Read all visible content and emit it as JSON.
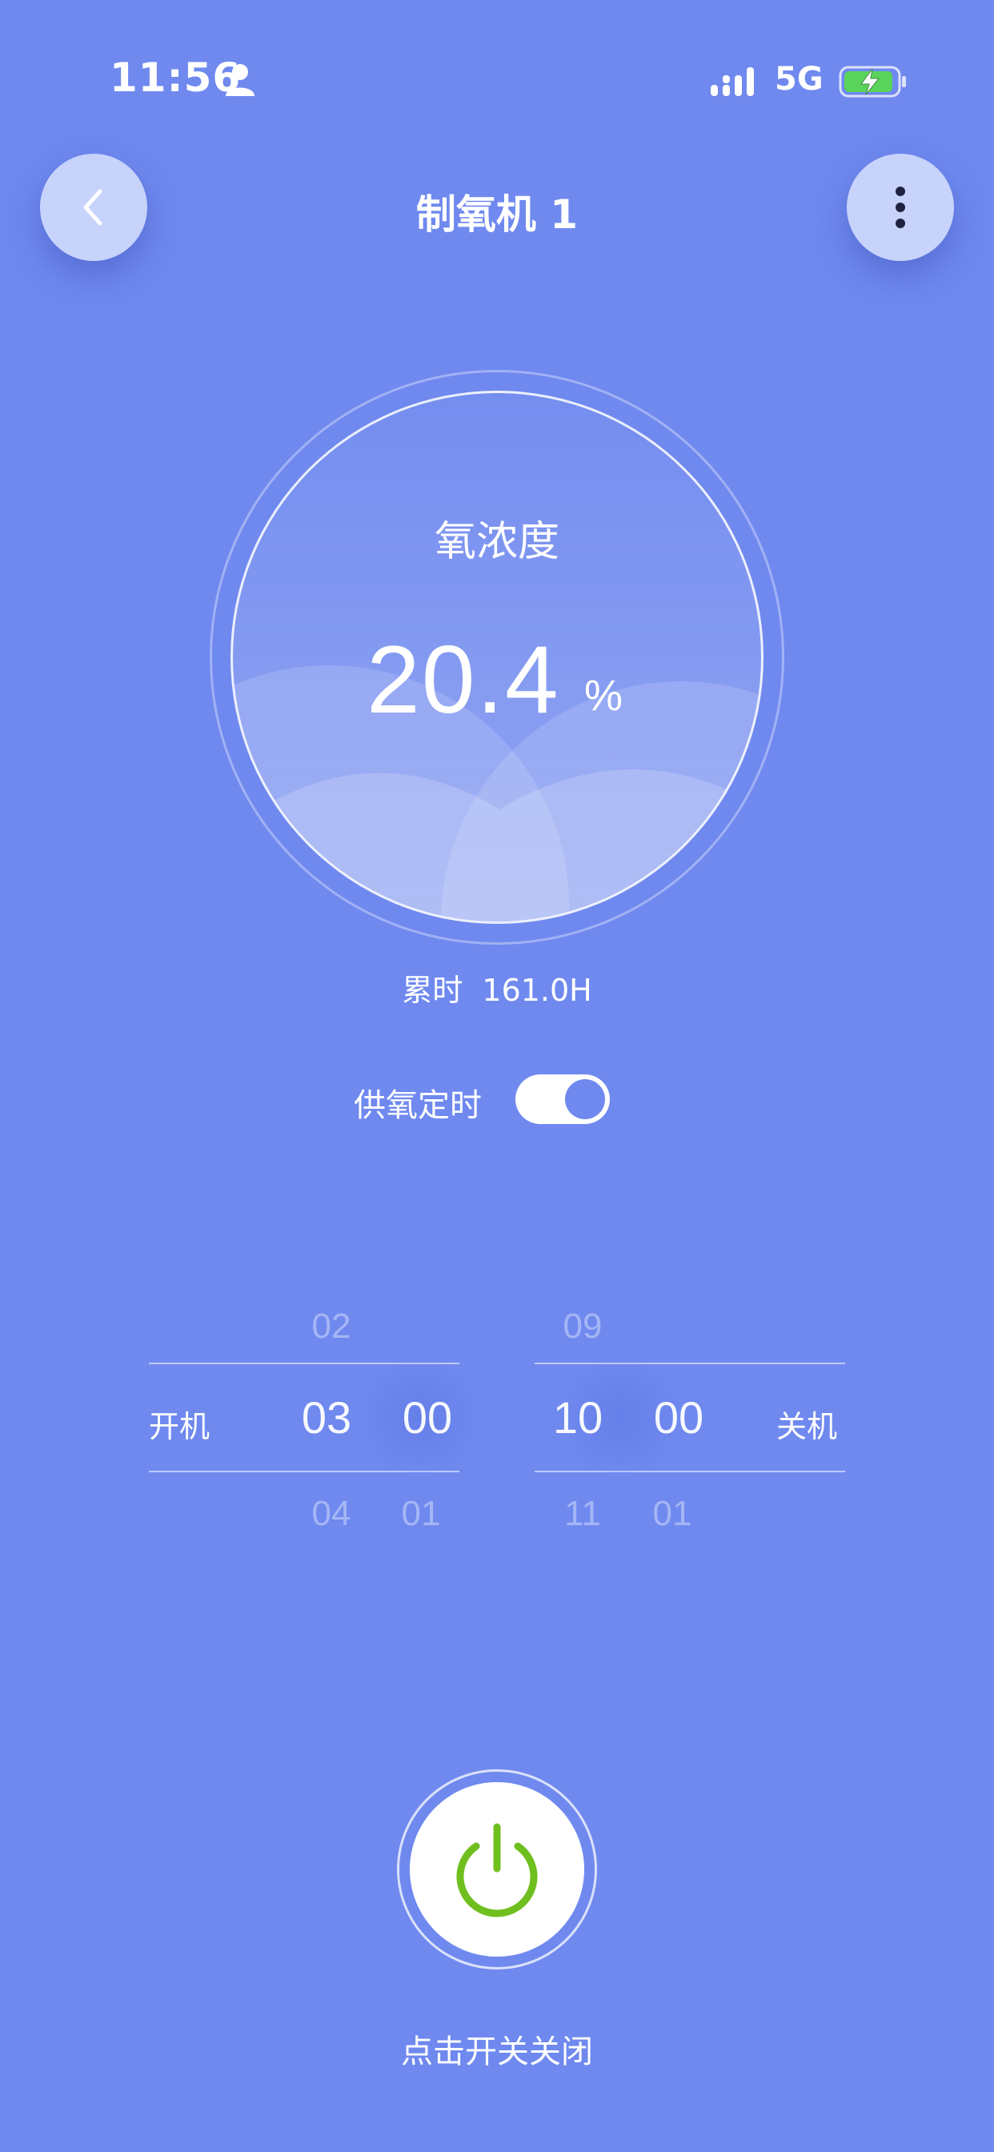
{
  "status_bar": {
    "time": "11:56",
    "network": "5G",
    "person_icon": "person-icon",
    "signal_icon": "signal-bars-icon",
    "battery_icon": "battery-charging-icon"
  },
  "header": {
    "title": "制氧机 1",
    "back_icon": "chevron-left-icon",
    "more_icon": "more-vertical-icon"
  },
  "gauge": {
    "label": "氧浓度",
    "value": "20.4",
    "unit": "%"
  },
  "runtime": {
    "text": "累时  161.0H"
  },
  "timer": {
    "label": "供氧定时",
    "enabled": true
  },
  "on_picker": {
    "label": "开机",
    "hour_prev": "02",
    "hour": "03",
    "hour_next": "04",
    "minute": "00",
    "minute_next": "01"
  },
  "off_picker": {
    "label": "关机",
    "hour_prev": "09",
    "hour": "10",
    "hour_next": "11",
    "minute": "00",
    "minute_next": "01"
  },
  "power": {
    "icon": "power-icon",
    "hint": "点击开关关闭"
  },
  "colors": {
    "background": "#6f89ef",
    "power_icon": "#6fbf1f",
    "button_light": "#c7d3fb"
  }
}
